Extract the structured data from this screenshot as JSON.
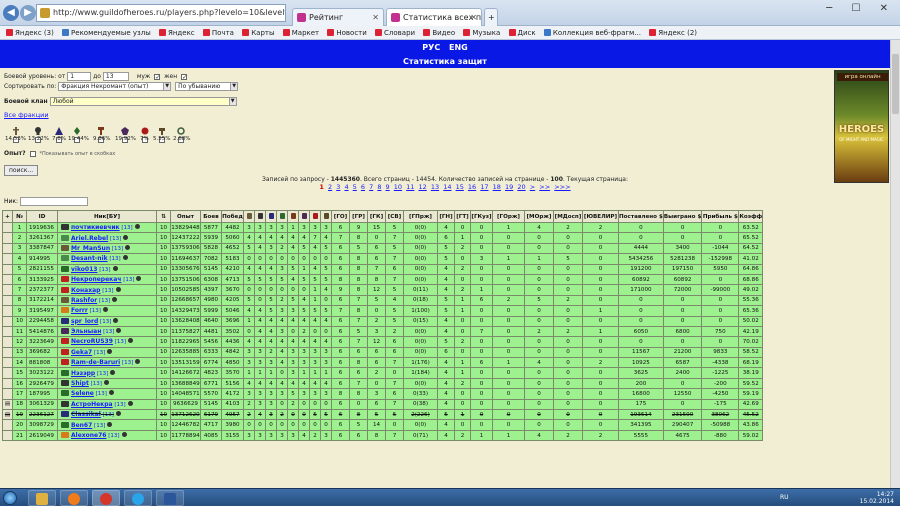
{
  "browser": {
    "address": "http://www.guildofheroes.ru/players.php?levelo=10&levelto=13&male=1&female=1&o",
    "tabs": [
      {
        "label": "http://www.guildofheroes.ru/...",
        "fav_color": "#c79a2e"
      },
      {
        "label": "Рейтинг",
        "fav_color": "#c2318f"
      },
      {
        "label": "Статистика всех персонаж...",
        "fav_color": "#c2318f"
      }
    ],
    "bookmarks": [
      "Яндекс (3)",
      "Рекомендуемые узлы",
      "Яндекс",
      "Почта",
      "Карты",
      "Маркет",
      "Новости",
      "Словари",
      "Видео",
      "Музыка",
      "Диск",
      "Коллекция веб-фрагм...",
      "Яндекс (2)"
    ]
  },
  "header": {
    "lang_ru": "РУС",
    "lang_en": "ENG",
    "title": "Статистика защит"
  },
  "filters": {
    "level_label": "Боевой уровень: от",
    "level_from": "1",
    "level_to_label": "до",
    "level_to": "13",
    "male_label": "муж",
    "female_label": "жен",
    "sort_label": "Сортировать по:",
    "sort_value": "Фракция Некромант (опыт)",
    "order_value": "По убыванию",
    "clan_label": "Боевой клан",
    "clan_value": "Любой",
    "all_factions_link": "Все фракции",
    "online_label": "Опыт?",
    "online_hint": "*Показывать опыт в скобках",
    "search_button": "поиск...",
    "nick_label": "Ник:"
  },
  "factions": [
    {
      "icon": "knight-icon",
      "pct": "14.53%",
      "color": "#6a5a3a"
    },
    {
      "icon": "necro-icon",
      "pct": "13.22%",
      "color": "#333333"
    },
    {
      "icon": "wizard-icon",
      "pct": "7.8%",
      "color": "#2a2a7a"
    },
    {
      "icon": "elf-icon",
      "pct": "19.44%",
      "color": "#2a6a2a"
    },
    {
      "icon": "barbarian-icon",
      "pct": "9.86%",
      "color": "#7a3a1a"
    },
    {
      "icon": "darkelf-icon",
      "pct": "19.92%",
      "color": "#4a2a5a"
    },
    {
      "icon": "demon-icon",
      "pct": "7%",
      "color": "#aa1a1a"
    },
    {
      "icon": "dwarf-icon",
      "pct": "5.55%",
      "color": "#5a4a2a"
    },
    {
      "icon": "tribal-icon",
      "pct": "2.68%",
      "color": "#3a5a3a"
    }
  ],
  "banner": {
    "top": "игра онлайн",
    "title": "HEROES",
    "sub": "OF MIGHT AND MAGIC"
  },
  "summary": {
    "text_a": "Записей по запросу - ",
    "total": "1445360",
    "text_b": ". Всего страниц - 14454. Количество записей на странице - ",
    "per_page": "100",
    "text_c": ". Текущая страница:"
  },
  "pagination": [
    "1",
    "2",
    "3",
    "4",
    "5",
    "6",
    "7",
    "8",
    "9",
    "10",
    "11",
    "12",
    "13",
    "14",
    "15",
    "16",
    "17",
    "18",
    "19",
    "20",
    ">",
    ">>",
    ">>>"
  ],
  "table": {
    "headers": [
      "+",
      "№",
      "ID",
      "Ник[БУ]",
      "",
      "Опыт",
      "Боев",
      "Побед",
      "",
      "",
      "",
      "",
      "",
      "",
      "",
      "",
      "[ГО]",
      "[ГР]",
      "[ГК]",
      "[СВ]",
      "[ГПрж]",
      "[ГН]",
      "[ГТ]",
      "[ГКуз]",
      "[ГОрж]",
      "[МОрж]",
      "[МДосп]",
      "[ЮВЕЛИР]",
      "Поставлено $",
      "Выиграно $",
      "Прибыль $",
      "Коэфф"
    ],
    "rows": [
      {
        "n": "1",
        "id": "1919636",
        "nick": "почтикиевчик",
        "lv": "[13]",
        "flag": "#333333",
        "c": "10",
        "exp": "13829448",
        "battles": "5877",
        "wins": "4482",
        "f": [
          "3",
          "3",
          "3",
          "3",
          "1",
          "3",
          "3",
          "3",
          "6",
          "9",
          "15",
          "5",
          "0(0)",
          "4",
          "0",
          "0",
          "1",
          "4",
          "2",
          "2",
          "0",
          "0",
          "0",
          "63.52"
        ]
      },
      {
        "n": "2",
        "id": "3261367",
        "nick": "Ariel.Rebel",
        "lv": "[13]",
        "flag": "#4a8a4a",
        "c": "10",
        "exp": "12437222",
        "battles": "5939",
        "wins": "5060",
        "f": [
          "4",
          "4",
          "4",
          "4",
          "4",
          "4",
          "7",
          "4",
          "7",
          "8",
          "0",
          "7",
          "0(0)",
          "6",
          "1",
          "0",
          "0",
          "0",
          "0",
          "0",
          "0",
          "0",
          "0",
          "65.52"
        ]
      },
      {
        "n": "3",
        "id": "3387847",
        "nick": "Mr_ManSun",
        "lv": "[13]",
        "flag": "#6a5a3a",
        "c": "10",
        "exp": "13759306",
        "battles": "5828",
        "wins": "4652",
        "f": [
          "5",
          "4",
          "3",
          "2",
          "4",
          "5",
          "4",
          "5",
          "6",
          "5",
          "6",
          "5",
          "0(0)",
          "5",
          "2",
          "0",
          "0",
          "0",
          "0",
          "0",
          "4444",
          "3400",
          "-1044",
          "64.52"
        ]
      },
      {
        "n": "4",
        "id": "914995",
        "nick": "Desant-nik",
        "lv": "[13]",
        "flag": "#4a8a4a",
        "c": "10",
        "exp": "11694637",
        "battles": "7082",
        "wins": "5183",
        "f": [
          "0",
          "0",
          "0",
          "0",
          "0",
          "0",
          "0",
          "0",
          "6",
          "8",
          "6",
          "7",
          "0(0)",
          "5",
          "0",
          "3",
          "1",
          "1",
          "5",
          "0",
          "5434256",
          "5281238",
          "-152998",
          "41.02"
        ]
      },
      {
        "n": "5",
        "id": "2821155",
        "nick": "viko013",
        "lv": "[13]",
        "flag": "#2a6a2a",
        "c": "10",
        "exp": "13305676",
        "battles": "5145",
        "wins": "4210",
        "f": [
          "4",
          "4",
          "4",
          "3",
          "5",
          "1",
          "4",
          "5",
          "6",
          "8",
          "7",
          "6",
          "0(0)",
          "4",
          "2",
          "0",
          "0",
          "0",
          "0",
          "0",
          "191200",
          "197150",
          "5950",
          "64.86"
        ]
      },
      {
        "n": "6",
        "id": "3133925",
        "nick": "Некроперекач",
        "lv": "[13]",
        "flag": "#c02020",
        "c": "10",
        "exp": "13751506",
        "battles": "6308",
        "wins": "4713",
        "f": [
          "5",
          "5",
          "5",
          "5",
          "4",
          "5",
          "5",
          "5",
          "8",
          "8",
          "8",
          "7",
          "0(0)",
          "4",
          "0",
          "0",
          "0",
          "0",
          "0",
          "0",
          "60892",
          "60892",
          "0",
          "68.86"
        ]
      },
      {
        "n": "7",
        "id": "2372377",
        "nick": "Конахар",
        "lv": "[13]",
        "flag": "#c02020",
        "c": "10",
        "exp": "10502585",
        "battles": "4397",
        "wins": "3670",
        "f": [
          "0",
          "0",
          "0",
          "0",
          "0",
          "0",
          "1",
          "4",
          "9",
          "8",
          "12",
          "5",
          "0(11)",
          "4",
          "2",
          "1",
          "0",
          "0",
          "0",
          "0",
          "171000",
          "72000",
          "-99000",
          "49.02"
        ]
      },
      {
        "n": "8",
        "id": "3172214",
        "nick": "Rashfor",
        "lv": "[13]",
        "flag": "#6a5a3a",
        "c": "10",
        "exp": "12668657",
        "battles": "4980",
        "wins": "4205",
        "f": [
          "5",
          "0",
          "5",
          "2",
          "5",
          "4",
          "1",
          "0",
          "6",
          "7",
          "5",
          "4",
          "0(18)",
          "5",
          "1",
          "6",
          "2",
          "5",
          "2",
          "0",
          "0",
          "0",
          "0",
          "55.36"
        ]
      },
      {
        "n": "9",
        "id": "3195497",
        "nick": "Forrr",
        "lv": "[13]",
        "flag": "#d87a1a",
        "c": "10",
        "exp": "14329473",
        "battles": "5999",
        "wins": "5046",
        "f": [
          "4",
          "4",
          "5",
          "3",
          "3",
          "5",
          "5",
          "5",
          "7",
          "8",
          "0",
          "5",
          "1(100)",
          "5",
          "1",
          "0",
          "0",
          "0",
          "0",
          "1",
          "0",
          "0",
          "0",
          "65.36"
        ]
      },
      {
        "n": "10",
        "id": "2294458",
        "nick": "spr_lord",
        "lv": "[13]",
        "flag": "#2a2a7a",
        "c": "10",
        "exp": "13628408",
        "battles": "4640",
        "wins": "3696",
        "f": [
          "1",
          "4",
          "4",
          "4",
          "4",
          "4",
          "4",
          "4",
          "6",
          "7",
          "2",
          "5",
          "0(15)",
          "4",
          "0",
          "0",
          "0",
          "0",
          "0",
          "0",
          "0",
          "0",
          "0",
          "50.02"
        ]
      },
      {
        "n": "11",
        "id": "5414876",
        "nick": "Эльныан",
        "lv": "[13]",
        "flag": "#4a2a5a",
        "c": "10",
        "exp": "11375827",
        "battles": "4481",
        "wins": "3502",
        "f": [
          "0",
          "4",
          "4",
          "3",
          "0",
          "2",
          "0",
          "0",
          "6",
          "5",
          "3",
          "2",
          "0(0)",
          "4",
          "0",
          "7",
          "0",
          "2",
          "2",
          "1",
          "6050",
          "6800",
          "750",
          "42.19"
        ]
      },
      {
        "n": "12",
        "id": "3223649",
        "nick": "NecroRUS39",
        "lv": "[13]",
        "flag": "#c02020",
        "c": "10",
        "exp": "11822965",
        "battles": "5456",
        "wins": "4436",
        "f": [
          "4",
          "4",
          "4",
          "4",
          "4",
          "4",
          "4",
          "4",
          "6",
          "7",
          "12",
          "6",
          "0(0)",
          "5",
          "2",
          "0",
          "0",
          "0",
          "0",
          "0",
          "0",
          "0",
          "0",
          "70.02"
        ]
      },
      {
        "n": "13",
        "id": "369682",
        "nick": "Gekа7",
        "lv": "[13]",
        "flag": "#c02020",
        "c": "10",
        "exp": "12635885",
        "battles": "6333",
        "wins": "4842",
        "f": [
          "3",
          "3",
          "2",
          "4",
          "3",
          "3",
          "3",
          "3",
          "6",
          "6",
          "6",
          "6",
          "0(0)",
          "6",
          "0",
          "0",
          "0",
          "0",
          "0",
          "0",
          "11567",
          "21200",
          "9833",
          "58.52"
        ]
      },
      {
        "n": "14",
        "id": "881808",
        "nick": "Ram-de-Baruri",
        "lv": "[13]",
        "flag": "#c02020",
        "c": "10",
        "exp": "13513159",
        "battles": "6774",
        "wins": "4850",
        "f": [
          "3",
          "3",
          "3",
          "4",
          "3",
          "3",
          "3",
          "3",
          "6",
          "8",
          "6",
          "7",
          "1(176)",
          "4",
          "1",
          "6",
          "1",
          "4",
          "0",
          "2",
          "10925",
          "6587",
          "-4338",
          "68.19"
        ]
      },
      {
        "n": "15",
        "id": "3023122",
        "nick": "Нэзэрр",
        "lv": "[13]",
        "flag": "#2a6a2a",
        "c": "10",
        "exp": "14126672",
        "battles": "4823",
        "wins": "3570",
        "f": [
          "1",
          "1",
          "1",
          "0",
          "3",
          "1",
          "1",
          "1",
          "6",
          "6",
          "2",
          "0",
          "1(184)",
          "4",
          "1",
          "0",
          "0",
          "0",
          "0",
          "0",
          "3625",
          "2400",
          "-1225",
          "38.19"
        ]
      },
      {
        "n": "16",
        "id": "2926479",
        "nick": "Shipt",
        "lv": "[13]",
        "flag": "#333333",
        "c": "10",
        "exp": "13688849",
        "battles": "6771",
        "wins": "5156",
        "f": [
          "4",
          "4",
          "4",
          "4",
          "4",
          "4",
          "4",
          "4",
          "6",
          "7",
          "0",
          "7",
          "0(0)",
          "4",
          "2",
          "0",
          "0",
          "0",
          "0",
          "0",
          "200",
          "0",
          "-200",
          "59.52"
        ]
      },
      {
        "n": "17",
        "id": "187995",
        "nick": "Selene",
        "lv": "[13]",
        "flag": "#2a6a2a",
        "c": "10",
        "exp": "14048571",
        "battles": "5570",
        "wins": "4172",
        "f": [
          "3",
          "3",
          "3",
          "3",
          "5",
          "3",
          "3",
          "3",
          "8",
          "8",
          "3",
          "6",
          "0(33)",
          "4",
          "0",
          "0",
          "0",
          "0",
          "0",
          "0",
          "16800",
          "12550",
          "-4250",
          "59.19"
        ]
      },
      {
        "n": "18",
        "id": "3061329",
        "nick": "АстроНекра",
        "lv": "[13]",
        "flag": "#333333",
        "c": "10",
        "exp": "9636629",
        "battles": "5145",
        "wins": "4103",
        "f": [
          "2",
          "3",
          "3",
          "0",
          "2",
          "0",
          "0",
          "0",
          "6",
          "0",
          "6",
          "7",
          "0(38)",
          "4",
          "0",
          "0",
          "0",
          "0",
          "0",
          "0",
          "175",
          "0",
          "-175",
          "42.69"
        ],
        "lead_icon": true
      },
      {
        "n": "19",
        "id": "2236127",
        "nick": "Classikal",
        "lv": "[13]",
        "flag": "#2a2a7a",
        "c": "10",
        "exp": "13712620",
        "battles": "6179",
        "wins": "4957",
        "f": [
          "2",
          "4",
          "3",
          "2",
          "0",
          "0",
          "5",
          "5",
          "6",
          "8",
          "5",
          "5",
          "2(226)",
          "5",
          "1",
          "0",
          "0",
          "0",
          "0",
          "0",
          "193614",
          "231500",
          "38062",
          "45.52"
        ],
        "struck": true,
        "lead_icon": true
      },
      {
        "n": "20",
        "id": "3098729",
        "nick": "Ben67",
        "lv": "[13]",
        "flag": "#2a6a2a",
        "c": "10",
        "exp": "12446782",
        "battles": "4717",
        "wins": "3980",
        "f": [
          "0",
          "0",
          "0",
          "0",
          "0",
          "0",
          "0",
          "0",
          "6",
          "5",
          "14",
          "0",
          "0(0)",
          "4",
          "0",
          "0",
          "0",
          "0",
          "0",
          "0",
          "341395",
          "290407",
          "-50988",
          "43.86"
        ]
      },
      {
        "n": "21",
        "id": "2619049",
        "nick": "Alexone76",
        "lv": "[13]",
        "flag": "#d87a1a",
        "c": "10",
        "exp": "11778894",
        "battles": "4085",
        "wins": "3155",
        "f": [
          "3",
          "3",
          "3",
          "3",
          "3",
          "4",
          "2",
          "3",
          "6",
          "6",
          "8",
          "7",
          "0(71)",
          "4",
          "2",
          "1",
          "1",
          "4",
          "2",
          "2",
          "5555",
          "4675",
          "-880",
          "59.02"
        ]
      }
    ]
  },
  "taskbar": {
    "apps": [
      {
        "icon": "explorer-icon",
        "color": "#e0b040"
      },
      {
        "icon": "media-icon",
        "color": "#ef7b1a"
      },
      {
        "icon": "yandex-browser-icon",
        "color": "#d4372a"
      },
      {
        "icon": "skype-icon",
        "color": "#2aa4e8"
      },
      {
        "icon": "word-icon",
        "color": "#2b579a"
      }
    ],
    "lang": "RU",
    "time": "14:27",
    "date": "15.02.2014"
  }
}
